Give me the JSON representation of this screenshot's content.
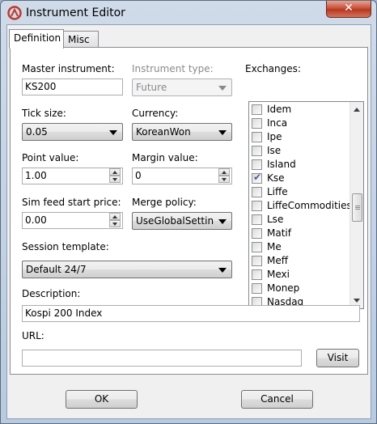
{
  "window": {
    "title": "Instrument Editor",
    "close_glyph": "✕"
  },
  "tabs": [
    {
      "label": "Definition"
    },
    {
      "label": "Misc"
    }
  ],
  "form": {
    "master_instrument": {
      "label": "Master instrument:",
      "value": "KS200"
    },
    "instrument_type": {
      "label": "Instrument type:",
      "value": "Future"
    },
    "tick_size": {
      "label": "Tick size:",
      "value": "0.05"
    },
    "currency": {
      "label": "Currency:",
      "value": "KoreanWon"
    },
    "point_value": {
      "label": "Point value:",
      "value": "1.00"
    },
    "margin_value": {
      "label": "Margin value:",
      "value": "0"
    },
    "sim_feed_start_price": {
      "label": "Sim feed start price:",
      "value": "0.00"
    },
    "merge_policy": {
      "label": "Merge policy:",
      "value": "UseGlobalSettings"
    },
    "session_template": {
      "label": "Session template:",
      "value": "Default 24/7"
    },
    "description": {
      "label": "Description:",
      "value": "Kospi 200 Index"
    },
    "url": {
      "label": "URL:",
      "value": ""
    },
    "visit_label": "Visit"
  },
  "exchanges": {
    "label": "Exchanges:",
    "check_glyph": "✔",
    "items": [
      {
        "name": "Idem",
        "checked": false
      },
      {
        "name": "Inca",
        "checked": false
      },
      {
        "name": "Ipe",
        "checked": false
      },
      {
        "name": "Ise",
        "checked": false
      },
      {
        "name": "Island",
        "checked": false
      },
      {
        "name": "Kse",
        "checked": true
      },
      {
        "name": "Liffe",
        "checked": false
      },
      {
        "name": "LiffeCommodities",
        "checked": false
      },
      {
        "name": "Lse",
        "checked": false
      },
      {
        "name": "Matif",
        "checked": false
      },
      {
        "name": "Me",
        "checked": false
      },
      {
        "name": "Meff",
        "checked": false
      },
      {
        "name": "Mexi",
        "checked": false
      },
      {
        "name": "Monep",
        "checked": false
      },
      {
        "name": "Nasdaq",
        "checked": false
      }
    ]
  },
  "buttons": {
    "ok": "OK",
    "cancel": "Cancel"
  },
  "colors": {
    "close_red": "#c7533c",
    "check_blue": "#4a5f97",
    "title_frame": "#b9cadf"
  }
}
